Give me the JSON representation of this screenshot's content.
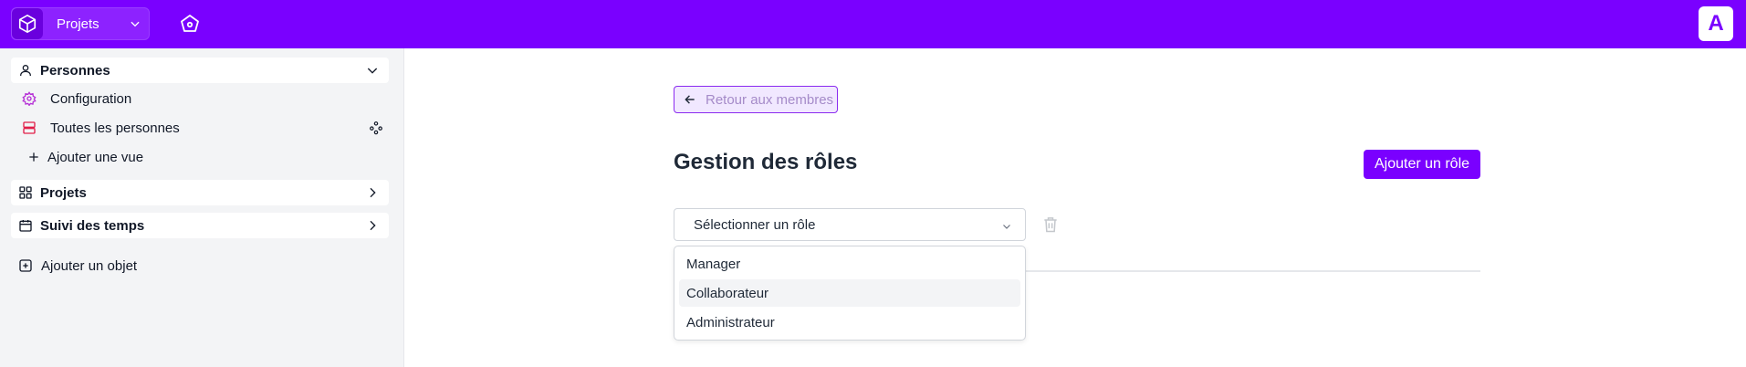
{
  "topbar": {
    "project_switch_label": "Projets",
    "avatar_letter": "A",
    "colors": {
      "brand": "#7a00ff"
    }
  },
  "sidebar": {
    "groups": [
      {
        "label": "Personnes",
        "icon": "user-icon",
        "expanded": true,
        "items": [
          {
            "label": "Configuration",
            "icon": "gear-icon"
          },
          {
            "label": "Toutes les personnes",
            "icon": "table-icon",
            "right_icon": "users-group-icon"
          },
          {
            "label": "Ajouter une vue",
            "icon": "plus-icon"
          }
        ]
      },
      {
        "label": "Projets",
        "icon": "grid-icon",
        "expanded": false
      },
      {
        "label": "Suivi des temps",
        "icon": "calendar-icon",
        "expanded": false
      }
    ],
    "add_object_label": "Ajouter un objet"
  },
  "main": {
    "back_label": "Retour aux membres",
    "title": "Gestion des rôles",
    "add_role_label": "Ajouter un rôle",
    "role_select": {
      "placeholder": "Sélectionner un rôle",
      "options": [
        "Manager",
        "Collaborateur",
        "Administrateur"
      ],
      "highlighted_option": "Collaborateur"
    }
  }
}
